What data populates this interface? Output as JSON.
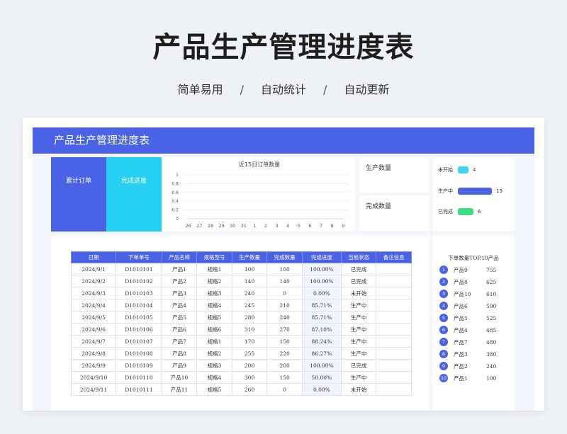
{
  "hero": {
    "title": "产品生产管理进度表",
    "tags": [
      "简单易用",
      "自动统计",
      "自动更新"
    ],
    "separator": "/"
  },
  "sheet": {
    "banner_title": "产品生产管理进度表",
    "kpi_orders_label": "累计订单",
    "kpi_progress_label": "完成进度",
    "production_qty_label": "生产数量",
    "completed_qty_label": "完成数量"
  },
  "status_summary": [
    {
      "label": "未开始",
      "value": "4",
      "color": "#3fd6f0",
      "fraction": 0.31
    },
    {
      "label": "生产中",
      "value": "13",
      "color": "#4a63e6",
      "fraction": 1.0
    },
    {
      "label": "已完成",
      "value": "6",
      "color": "#3ddc84",
      "fraction": 0.46
    }
  ],
  "chart_data": {
    "type": "line",
    "title": "近15日订单数量",
    "categories": [
      "26",
      "27",
      "28",
      "29",
      "30",
      "31",
      "1",
      "2",
      "3",
      "4",
      "5",
      "6",
      "7",
      "8",
      "9"
    ],
    "y_ticks": [
      "1",
      "0.8",
      "0.6",
      "0.4",
      "0.2",
      "0"
    ],
    "ylim": [
      0,
      1
    ],
    "series": [
      {
        "values": [
          0,
          0,
          0,
          0,
          0,
          0,
          0,
          0,
          0,
          0,
          0,
          0,
          0,
          0,
          0
        ]
      }
    ],
    "grid": true
  },
  "table": {
    "headers": [
      "日期",
      "下单单号",
      "产品名称",
      "规格型号",
      "生产数量",
      "完成数量",
      "完成进度",
      "当前状态",
      "备注信息"
    ],
    "rows": [
      [
        "2024/9/1",
        "D1010101",
        "产品1",
        "规格1",
        "100",
        "100",
        "100.00%",
        "已完成",
        ""
      ],
      [
        "2024/9/2",
        "D1010102",
        "产品2",
        "规格2",
        "140",
        "140",
        "100.00%",
        "已完成",
        ""
      ],
      [
        "2024/9/3",
        "D1010103",
        "产品3",
        "规格3",
        "240",
        "0",
        "0.00%",
        "未开始",
        ""
      ],
      [
        "2024/9/4",
        "D1010104",
        "产品4",
        "规格4",
        "245",
        "210",
        "85.71%",
        "生产中",
        ""
      ],
      [
        "2024/9/5",
        "D1010105",
        "产品5",
        "规格5",
        "280",
        "240",
        "85.71%",
        "生产中",
        ""
      ],
      [
        "2024/9/6",
        "D1010106",
        "产品6",
        "规格6",
        "310",
        "270",
        "87.10%",
        "生产中",
        ""
      ],
      [
        "2024/9/7",
        "D1010107",
        "产品7",
        "规格1",
        "170",
        "150",
        "88.24%",
        "生产中",
        ""
      ],
      [
        "2024/9/8",
        "D1010108",
        "产品8",
        "规格2",
        "255",
        "220",
        "86.27%",
        "生产中",
        ""
      ],
      [
        "2024/9/9",
        "D1010109",
        "产品9",
        "规格3",
        "200",
        "200",
        "100.00%",
        "已完成",
        ""
      ],
      [
        "2024/9/10",
        "D1010110",
        "产品10",
        "规格4",
        "300",
        "150",
        "50.00%",
        "生产中",
        ""
      ],
      [
        "2024/9/11",
        "D1010111",
        "产品11",
        "规格5",
        "260",
        "0",
        "0.00%",
        "未开始",
        ""
      ]
    ]
  },
  "top10": {
    "title": "下单数量TOP.10产品",
    "items": [
      {
        "rank": "1",
        "name": "产品9",
        "value": "755"
      },
      {
        "rank": "2",
        "name": "产品8",
        "value": "625"
      },
      {
        "rank": "3",
        "name": "产品10",
        "value": "610"
      },
      {
        "rank": "4",
        "name": "产品6",
        "value": "590"
      },
      {
        "rank": "5",
        "name": "产品5",
        "value": "525"
      },
      {
        "rank": "6",
        "name": "产品4",
        "value": "485"
      },
      {
        "rank": "7",
        "name": "产品7",
        "value": "480"
      },
      {
        "rank": "8",
        "name": "产品3",
        "value": "380"
      },
      {
        "rank": "9",
        "name": "产品2",
        "value": "240"
      },
      {
        "rank": "10",
        "name": "产品1",
        "value": "100"
      }
    ]
  }
}
